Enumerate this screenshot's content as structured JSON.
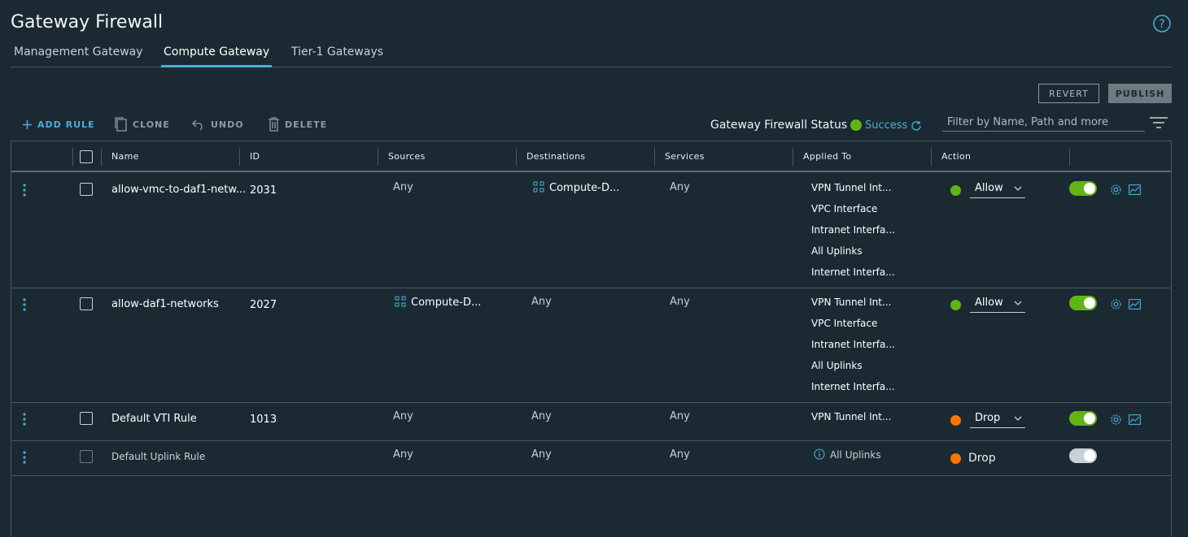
{
  "page": {
    "title": "Gateway Firewall"
  },
  "tabs": [
    {
      "label": "Management Gateway"
    },
    {
      "label": "Compute Gateway"
    },
    {
      "label": "Tier-1 Gateways"
    }
  ],
  "buttons": {
    "revert": "REVERT",
    "publish": "PUBLISH"
  },
  "toolbar": {
    "add_rule": "ADD RULE",
    "clone": "CLONE",
    "undo": "UNDO",
    "delete": "DELETE"
  },
  "status": {
    "label": "Gateway Firewall Status",
    "value": "Success",
    "color": "#60b515"
  },
  "filter": {
    "placeholder": "Filter by Name, Path and more"
  },
  "columns": {
    "name": "Name",
    "id": "ID",
    "sources": "Sources",
    "destinations": "Destinations",
    "services": "Services",
    "applied_to": "Applied To",
    "action": "Action"
  },
  "rows": [
    {
      "name": "allow-vmc-to-daf1-netw...",
      "id": "2031",
      "sources": "Any",
      "destinations": "Compute-D...",
      "services": "Any",
      "applied_to": [
        "VPN Tunnel Int...",
        "VPC Interface",
        "Intranet Interfa...",
        "All Uplinks",
        "Internet Interfa..."
      ],
      "action": "Allow",
      "action_color": "#60b515",
      "enabled": true
    },
    {
      "name": "allow-daf1-networks",
      "id": "2027",
      "sources": "Compute-D...",
      "destinations": "Any",
      "services": "Any",
      "applied_to": [
        "VPN Tunnel Int...",
        "VPC Interface",
        "Intranet Interfa...",
        "All Uplinks",
        "Internet Interfa..."
      ],
      "action": "Allow",
      "action_color": "#60b515",
      "enabled": true
    },
    {
      "name": "Default VTI Rule",
      "id": "1013",
      "sources": "Any",
      "destinations": "Any",
      "services": "Any",
      "applied_to": [
        "VPN Tunnel Int..."
      ],
      "action": "Drop",
      "action_color": "#f57600",
      "enabled": true
    },
    {
      "name": "Default Uplink Rule",
      "id": "",
      "sources": "Any",
      "destinations": "Any",
      "services": "Any",
      "applied_to": [
        "All Uplinks"
      ],
      "action": "Drop",
      "action_color": "#f57600",
      "enabled": false
    }
  ],
  "colors": {
    "accent": "#49afd9",
    "background": "#1b2a32",
    "allow": "#60b515",
    "drop": "#f57600"
  },
  "icons": [
    "help-icon",
    "plus-icon",
    "clone-icon",
    "undo-icon",
    "trash-icon",
    "refresh-icon",
    "filter-icon",
    "kebab-icon",
    "group-icon",
    "info-icon",
    "chevron-down-icon",
    "gear-icon",
    "graph-icon"
  ]
}
